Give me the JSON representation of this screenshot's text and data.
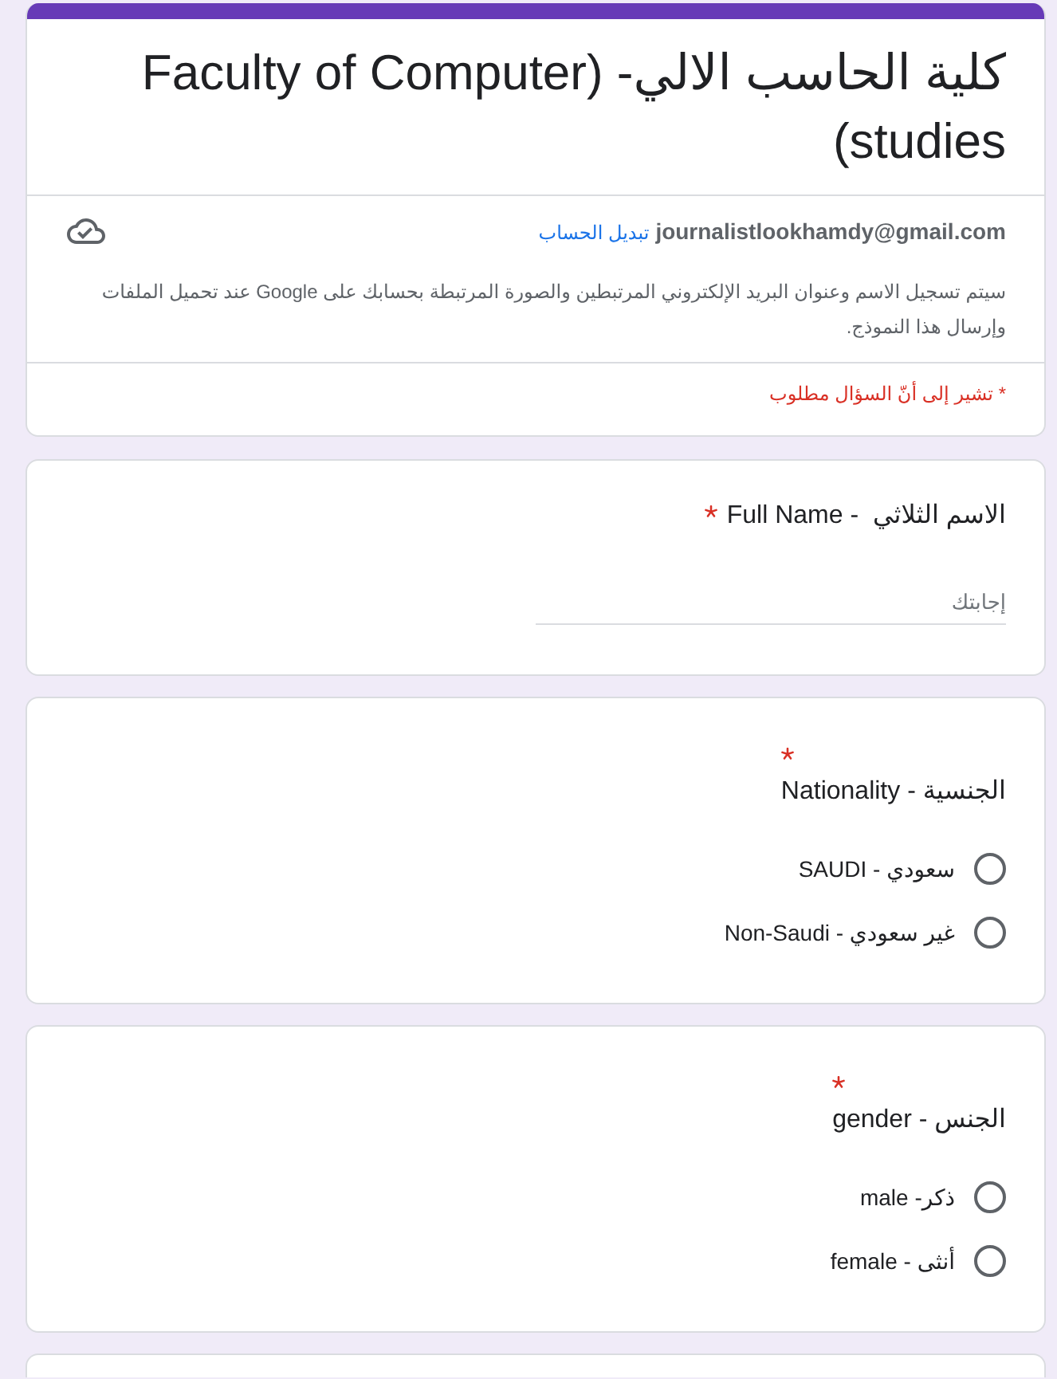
{
  "header": {
    "title": "كلية الحاسب الالي- (Faculty of Computer studies)",
    "account_email": "journalistlookhamdy@gmail.com",
    "switch_account_link": "تبديل الحساب",
    "privacy_notice": "سيتم تسجيل الاسم وعنوان البريد الإلكتروني المرتبطين والصورة المرتبطة بحسابك على Google عند تحميل الملفات وإرسال هذا النموذج.",
    "required_note": "* تشير إلى أنّ السؤال مطلوب"
  },
  "questions": [
    {
      "kind": "short_answer",
      "title": "الاسم الثلاثي  - Full Name",
      "required": true,
      "placeholder": "إجابتك"
    },
    {
      "kind": "radio",
      "title": "الجنسية - Nationality",
      "required": true,
      "options": [
        {
          "label": "سعودي - SAUDI",
          "selected": false
        },
        {
          "label": "غير سعودي - Non-Saudi",
          "selected": false
        }
      ]
    },
    {
      "kind": "radio",
      "title": "الجنس - gender",
      "required": true,
      "options": [
        {
          "label": "ذكر- male",
          "selected": false
        },
        {
          "label": "أنثى - female",
          "selected": false
        }
      ]
    }
  ]
}
